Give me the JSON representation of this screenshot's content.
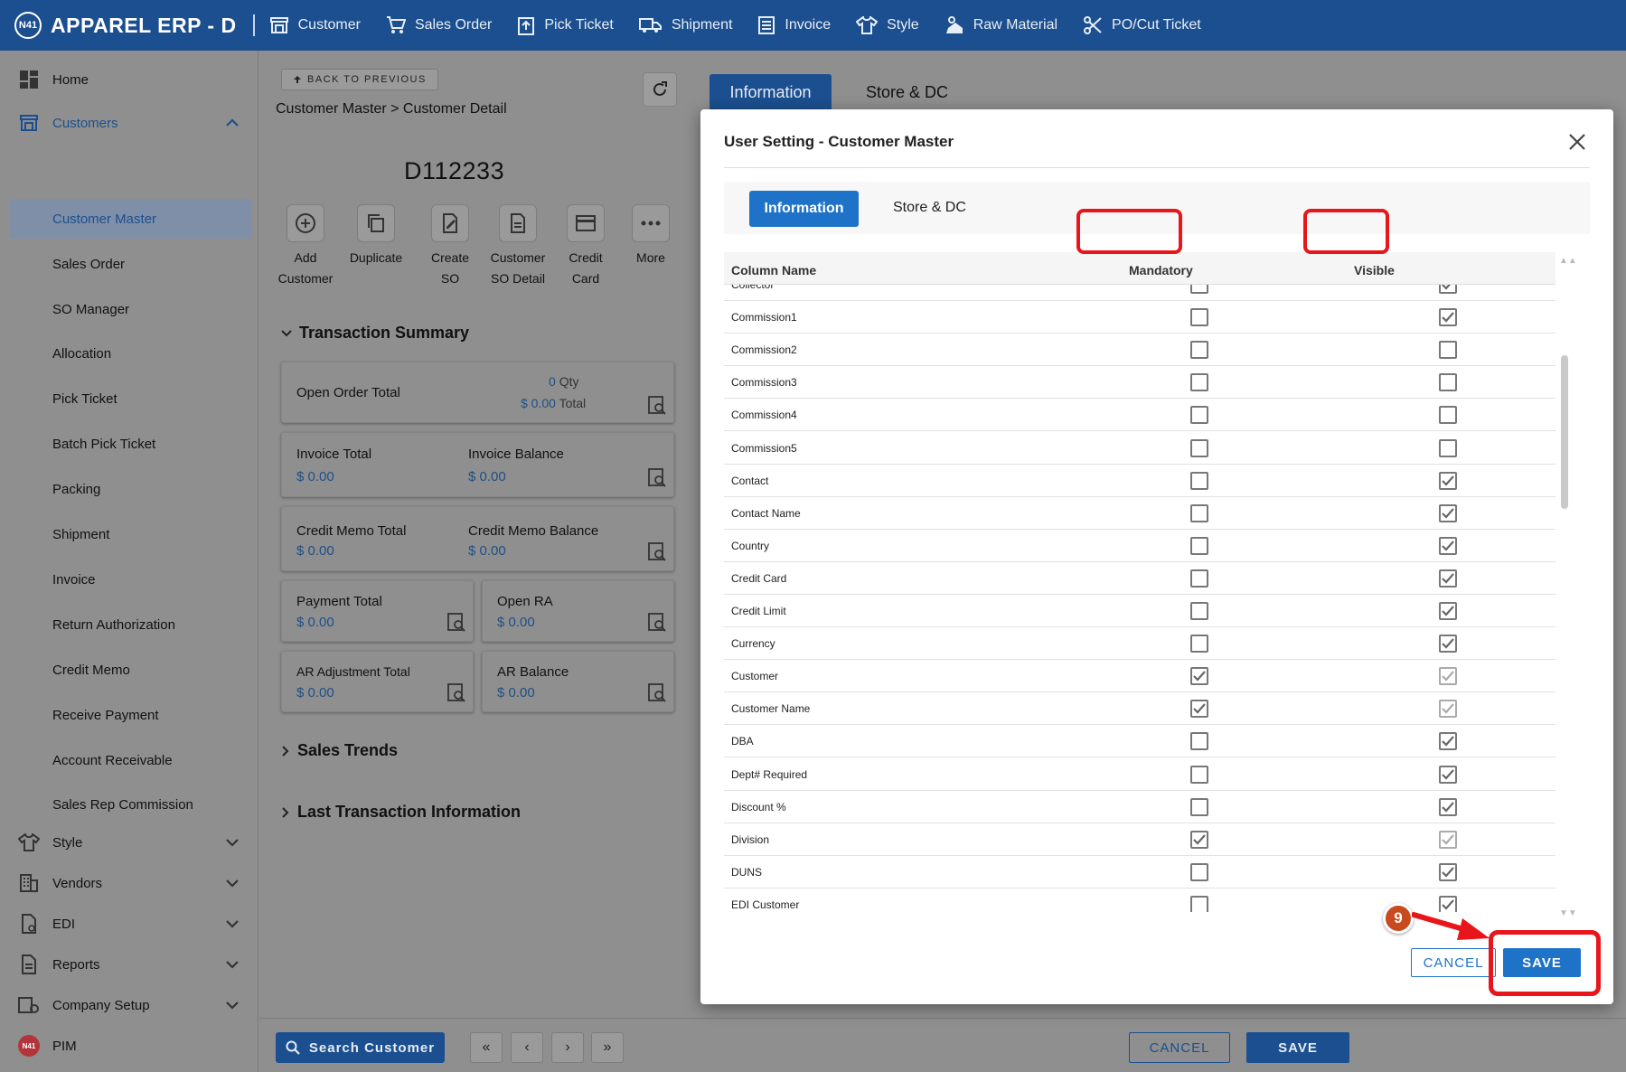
{
  "topbar": {
    "logo": "N41",
    "app_title": "APPAREL ERP  -  D",
    "nav": [
      {
        "label": "Customer",
        "icon": "customer-icon"
      },
      {
        "label": "Sales Order",
        "icon": "cart-icon"
      },
      {
        "label": "Pick Ticket",
        "icon": "pick-ticket-icon"
      },
      {
        "label": "Shipment",
        "icon": "truck-icon"
      },
      {
        "label": "Invoice",
        "icon": "invoice-icon"
      },
      {
        "label": "Style",
        "icon": "shirt-icon"
      },
      {
        "label": "Raw Material",
        "icon": "raw-material-icon"
      },
      {
        "label": "PO/Cut Ticket",
        "icon": "scissors-icon"
      }
    ]
  },
  "sidebar": {
    "home": "Home",
    "customers": "Customers",
    "customer_items": [
      "Customer Master",
      "Sales Order",
      "SO Manager",
      "Allocation",
      "Pick Ticket",
      "Batch Pick Ticket",
      "Packing",
      "Shipment",
      "Invoice",
      "Return Authorization",
      "Credit Memo",
      "Receive Payment",
      "Account Receivable",
      "Sales Rep Commission"
    ],
    "groups": [
      "Style",
      "Vendors",
      "EDI",
      "Reports",
      "Company Setup"
    ],
    "pim": "PIM",
    "pim_logo": "N41"
  },
  "detail": {
    "back_label": "BACK TO PREVIOUS",
    "breadcrumb": "Customer Master > Customer Detail",
    "customer_code": "D112233",
    "actions": [
      {
        "line1": "Add",
        "line2": "Customer"
      },
      {
        "line1": "Duplicate",
        "line2": ""
      },
      {
        "line1": "Create",
        "line2": "SO"
      },
      {
        "line1": "Customer",
        "line2": "SO Detail"
      },
      {
        "line1": "Credit",
        "line2": "Card"
      },
      {
        "line1": "More",
        "line2": ""
      }
    ],
    "transaction_summary": "Transaction Summary",
    "open_order_total": "Open Order Total",
    "open_order_qty": "0",
    "qty_label": "Qty",
    "open_order_amount": "$ 0.00",
    "total_label": "Total",
    "invoice_total": "Invoice Total",
    "invoice_total_val": "$ 0.00",
    "invoice_balance": "Invoice Balance",
    "invoice_balance_val": "$ 0.00",
    "credit_memo_total": "Credit Memo Total",
    "credit_memo_total_val": "$ 0.00",
    "credit_memo_balance": "Credit Memo Balance",
    "credit_memo_balance_val": "$ 0.00",
    "payment_total": "Payment Total",
    "payment_total_val": "$ 0.00",
    "open_ra": "Open RA",
    "open_ra_val": "$ 0.00",
    "ar_adjustment_total": "AR Adjustment Total",
    "ar_adjustment_total_val": "$ 0.00",
    "ar_balance": "AR Balance",
    "ar_balance_val": "$ 0.00",
    "sales_trends": "Sales Trends",
    "last_transaction": "Last Transaction Information"
  },
  "bottom": {
    "search": "Search Customer",
    "first": "«",
    "prev": "‹",
    "next": "›",
    "last": "»",
    "cancel": "CANCEL",
    "save": "SAVE"
  },
  "bg_tabs": {
    "information": "Information",
    "store_dc": "Store & DC"
  },
  "modal": {
    "title": "User Setting - Customer Master",
    "tab_information": "Information",
    "tab_store_dc": "Store & DC",
    "col_name": "Column Name",
    "col_mandatory": "Mandatory",
    "col_visible": "Visible",
    "rows": [
      {
        "name": "Collector",
        "mandatory": false,
        "visible": true,
        "visible_locked": false
      },
      {
        "name": "Commission1",
        "mandatory": false,
        "visible": true,
        "visible_locked": false
      },
      {
        "name": "Commission2",
        "mandatory": false,
        "visible": false,
        "visible_locked": false
      },
      {
        "name": "Commission3",
        "mandatory": false,
        "visible": false,
        "visible_locked": false
      },
      {
        "name": "Commission4",
        "mandatory": false,
        "visible": false,
        "visible_locked": false
      },
      {
        "name": "Commission5",
        "mandatory": false,
        "visible": false,
        "visible_locked": false
      },
      {
        "name": "Contact",
        "mandatory": false,
        "visible": true,
        "visible_locked": false
      },
      {
        "name": "Contact Name",
        "mandatory": false,
        "visible": true,
        "visible_locked": false
      },
      {
        "name": "Country",
        "mandatory": false,
        "visible": true,
        "visible_locked": false
      },
      {
        "name": "Credit Card",
        "mandatory": false,
        "visible": true,
        "visible_locked": false
      },
      {
        "name": "Credit Limit",
        "mandatory": false,
        "visible": true,
        "visible_locked": false
      },
      {
        "name": "Currency",
        "mandatory": false,
        "visible": true,
        "visible_locked": false
      },
      {
        "name": "Customer",
        "mandatory": true,
        "visible": true,
        "visible_locked": true
      },
      {
        "name": "Customer Name",
        "mandatory": true,
        "visible": true,
        "visible_locked": true
      },
      {
        "name": "DBA",
        "mandatory": false,
        "visible": true,
        "visible_locked": false
      },
      {
        "name": "Dept# Required",
        "mandatory": false,
        "visible": true,
        "visible_locked": false
      },
      {
        "name": "Discount %",
        "mandatory": false,
        "visible": true,
        "visible_locked": false
      },
      {
        "name": "Division",
        "mandatory": true,
        "visible": true,
        "visible_locked": true
      },
      {
        "name": "DUNS",
        "mandatory": false,
        "visible": true,
        "visible_locked": false
      },
      {
        "name": "EDI Customer",
        "mandatory": false,
        "visible": true,
        "visible_locked": false
      }
    ],
    "cancel": "CANCEL",
    "save": "SAVE",
    "step": "9"
  },
  "colors": {
    "brand": "#1c4f8f",
    "accent": "#1e73c8",
    "highlight": "#e8151b",
    "step": "#c84a1d"
  }
}
